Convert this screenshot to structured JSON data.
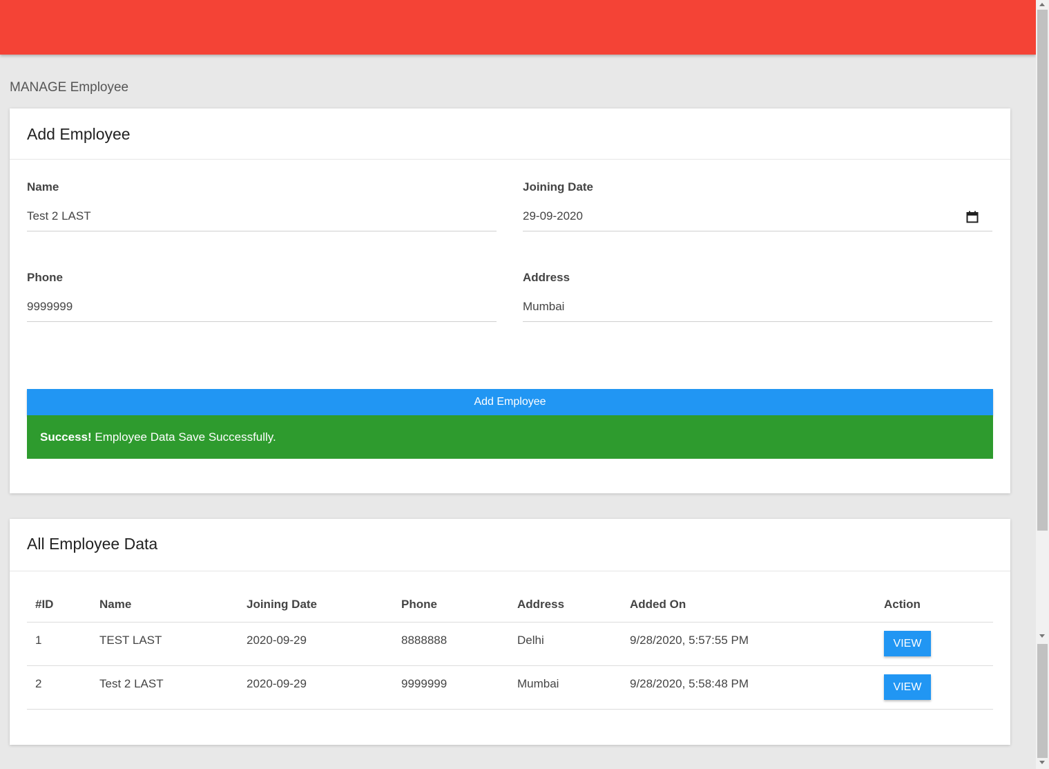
{
  "page": {
    "heading": "MANAGE Employee"
  },
  "form": {
    "title": "Add Employee",
    "name_label": "Name",
    "name_value": "Test 2 LAST",
    "joining_label": "Joining Date",
    "joining_value": "29-09-2020",
    "phone_label": "Phone",
    "phone_value": "9999999",
    "address_label": "Address",
    "address_value": "Mumbai",
    "submit_label": "Add Employee"
  },
  "alert": {
    "strong": "Success!",
    "message": " Employee Data Save Successfully."
  },
  "table": {
    "title": "All Employee Data",
    "headers": [
      "#ID",
      "Name",
      "Joining Date",
      "Phone",
      "Address",
      "Added On",
      "Action"
    ],
    "rows": [
      {
        "id": "1",
        "name": "TEST LAST",
        "joining": "2020-09-29",
        "phone": "8888888",
        "address": "Delhi",
        "added_on": "9/28/2020, 5:57:55 PM",
        "action": "VIEW"
      },
      {
        "id": "2",
        "name": "Test 2 LAST",
        "joining": "2020-09-29",
        "phone": "9999999",
        "address": "Mumbai",
        "added_on": "9/28/2020, 5:58:48 PM",
        "action": "VIEW"
      }
    ]
  },
  "colors": {
    "topbar": "#f44336",
    "primary": "#2196f3",
    "success": "#2e9b2e"
  },
  "icons": {
    "date_picker": "calendar-icon"
  }
}
